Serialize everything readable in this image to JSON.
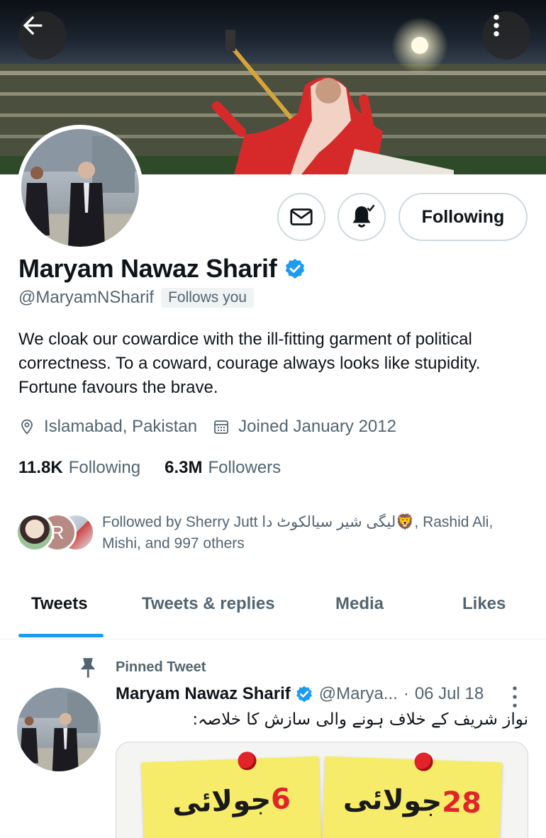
{
  "profile": {
    "display_name": "Maryam Nawaz Sharif",
    "handle": "@MaryamNSharif",
    "follows_you": "Follows you",
    "bio": "We cloak our cowardice with the ill-fitting garment of political correctness. To a coward, courage always looks like stupidity. Fortune favours the brave.",
    "location": "Islamabad, Pakistan",
    "joined": "Joined January 2012",
    "following_count": "11.8K",
    "following_label": "Following",
    "followers_count": "6.3M",
    "followers_label": "Followers",
    "followed_by": "Followed by Sherry Jutt لیگی شیر سیالکوٹ دا🦁, Rashid Ali, Mishi, and 997 others",
    "followed_avatar_initial": "R"
  },
  "actions": {
    "following_label": "Following"
  },
  "tabs": [
    {
      "label": "Tweets"
    },
    {
      "label": "Tweets & replies"
    },
    {
      "label": "Media"
    },
    {
      "label": "Likes"
    }
  ],
  "tweet": {
    "pinned_label": "Pinned Tweet",
    "author_name": "Maryam Nawaz Sharif",
    "author_handle": "@Marya...",
    "separator": "·",
    "date": "06 Jul 18",
    "text": "نواز شریف کے خلاف ہونے والی سازش کا خلاصہ:",
    "media_notes": [
      {
        "number": "6",
        "word": "جولائی"
      },
      {
        "number": "28",
        "word": "جولائی"
      }
    ]
  },
  "icons": {
    "back": "arrow-left-icon",
    "more": "more-vertical-icon",
    "message": "envelope-icon",
    "notify": "bell-icon",
    "verified": "verified-badge-icon",
    "location": "location-pin-icon",
    "calendar": "calendar-icon",
    "pin": "pin-icon"
  },
  "colors": {
    "accent": "#1d9bf0",
    "text_primary": "#0f1419",
    "text_secondary": "#536471",
    "border": "#cfd9de"
  }
}
